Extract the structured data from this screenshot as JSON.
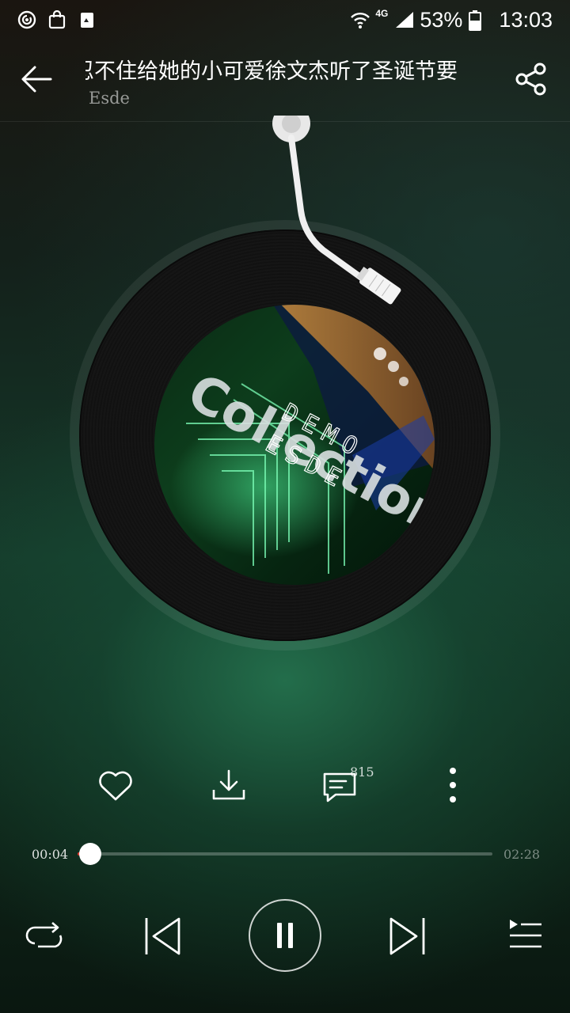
{
  "status_bar": {
    "left_icons": [
      "netease-cloud-music-icon",
      "shopping-bag-icon",
      "cleaner-icon"
    ],
    "network": "4G",
    "battery": "53%",
    "time": "13:03"
  },
  "header": {
    "title": "忍不住给她的小可爱徐文杰听了圣诞节要",
    "artist": "Esde"
  },
  "album_cover": {
    "text_main": "Collection",
    "text_sub": "DEMO",
    "text_sub2": "ESDE"
  },
  "actions": {
    "comment_count": "815"
  },
  "player": {
    "current_time": "00:04",
    "total_time": "02:28",
    "progress": 0.03,
    "state": "playing"
  },
  "colors": {
    "accent": "#e0362c",
    "background_green": "#1f6a48"
  }
}
